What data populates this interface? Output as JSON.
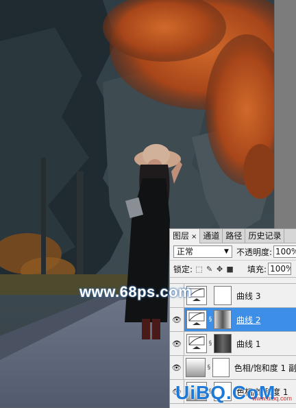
{
  "layers_panel": {
    "tabs": [
      {
        "label": "图层",
        "active": true,
        "close": "×"
      },
      {
        "label": "通道",
        "active": false
      },
      {
        "label": "路径",
        "active": false
      },
      {
        "label": "历史记录",
        "active": false
      }
    ],
    "blend_mode": "正常",
    "opacity_label": "不透明度:",
    "opacity_value": "100%",
    "lock_label": "锁定:",
    "fill_label": "填充:",
    "fill_value": "100%",
    "layers": [
      {
        "name": "曲线 3",
        "visible": false,
        "selected": false,
        "type": "curves"
      },
      {
        "name": "曲线 2",
        "visible": true,
        "selected": true,
        "type": "curves"
      },
      {
        "name": "曲线 1",
        "visible": true,
        "selected": false,
        "type": "curves"
      },
      {
        "name": "色相/饱和度 1 副",
        "visible": true,
        "selected": false,
        "type": "hue-saturation"
      },
      {
        "name": "色相/饱和度 1",
        "visible": true,
        "selected": false,
        "type": "hue-saturation"
      }
    ]
  },
  "watermarks": {
    "site": "www.68ps.com",
    "brand": "UiBQ.CoM",
    "brand_sub": "www.uibq.com"
  },
  "colors": {
    "selection": "#3d8ee6",
    "panel_bg": "#f0f0f0",
    "foliage_orange": "#b8521e"
  }
}
